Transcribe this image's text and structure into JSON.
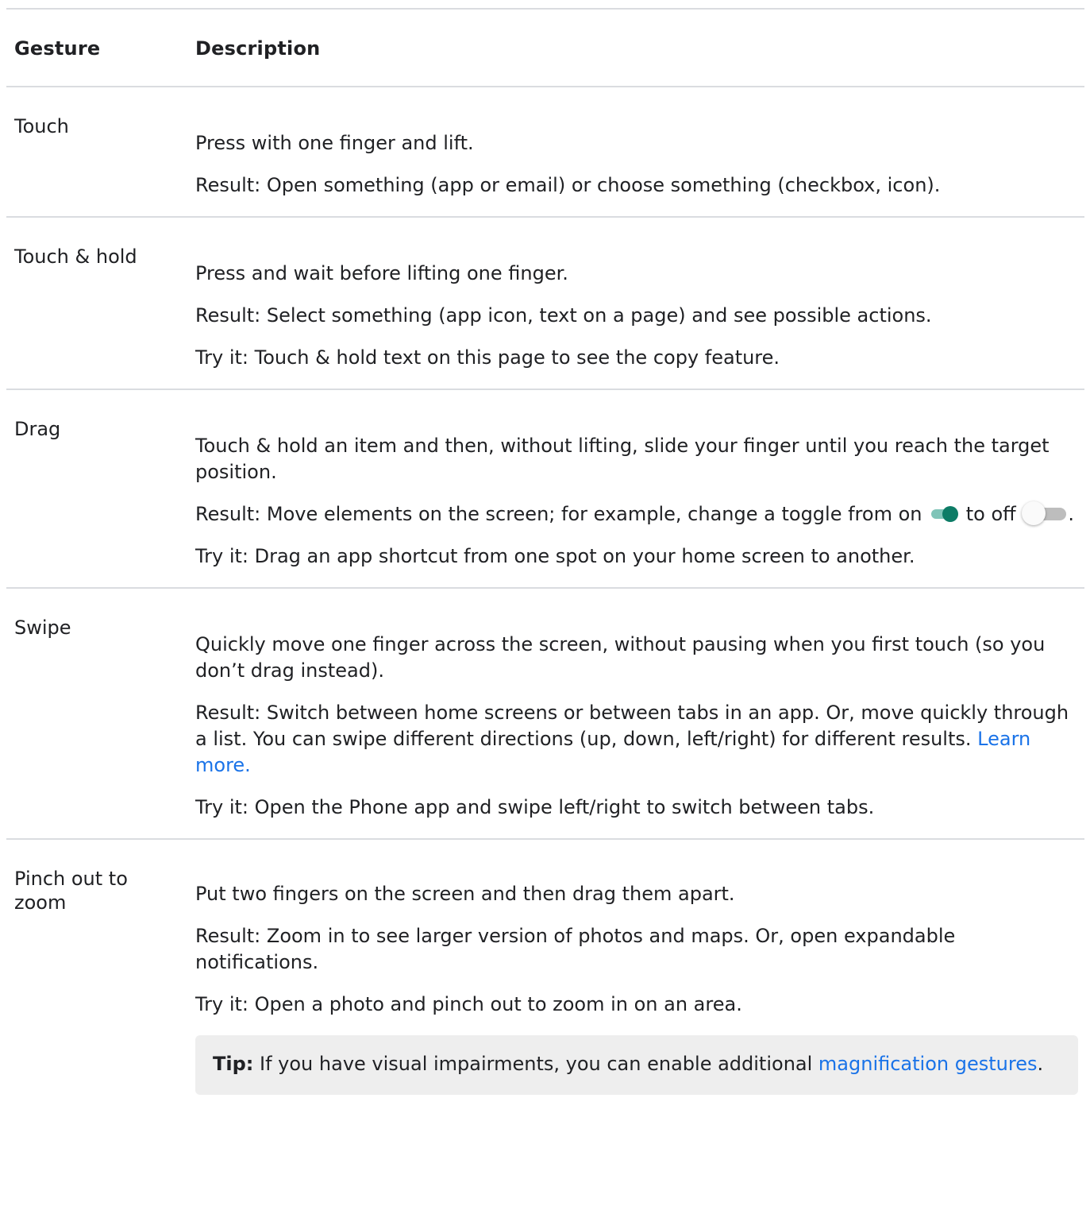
{
  "table": {
    "headers": {
      "gesture": "Gesture",
      "description": "Description"
    },
    "rows": [
      {
        "gesture": "Touch",
        "lines": [
          "Press with one finger and lift.",
          "Result: Open something (app or email) or choose something (checkbox, icon)."
        ]
      },
      {
        "gesture": "Touch & hold",
        "lines": [
          "Press and wait before lifting one finger.",
          "Result: Select something (app icon, text on a page) and see possible actions.",
          "Try it: Touch & hold text on this page to see the copy feature."
        ]
      },
      {
        "gesture": "Drag",
        "lines": [
          "Touch & hold an item and then, without lifting, slide your finger until you reach the target position.",
          "Try it: Drag an app shortcut from one spot on your home screen to another."
        ],
        "result_parts": {
          "before_on": "Result: Move elements on the screen; for example, change a toggle from on",
          "before_off": "to off",
          "end": "."
        }
      },
      {
        "gesture": "Swipe",
        "lines": [
          "Quickly move one finger across the screen, without pausing when you first touch (so you don’t drag instead).",
          "Try it: Open the Phone app and swipe left/right to switch between tabs."
        ],
        "result_text": "Result: Switch between home screens or between tabs in an app. Or, move quickly through a list. You can swipe different directions (up, down, left/right) for different results.",
        "result_link": "Learn more."
      },
      {
        "gesture": "Pinch out to zoom",
        "lines": [
          "Put two fingers on the screen and then drag them apart.",
          "Result: Zoom in to see larger version of photos and maps. Or, open expandable notifications.",
          "Try it: Open a photo and pinch out to zoom in on an area."
        ],
        "tip": {
          "label": "Tip:",
          "text": "If you have visual impairments, you can enable additional",
          "link": "magnification gestures",
          "end": "."
        }
      }
    ]
  },
  "colors": {
    "text": "#202124",
    "link": "#1a73e8",
    "divider": "#dadce0",
    "toggle_on": "#0d7c66",
    "tip_bg": "#eeeeee"
  }
}
